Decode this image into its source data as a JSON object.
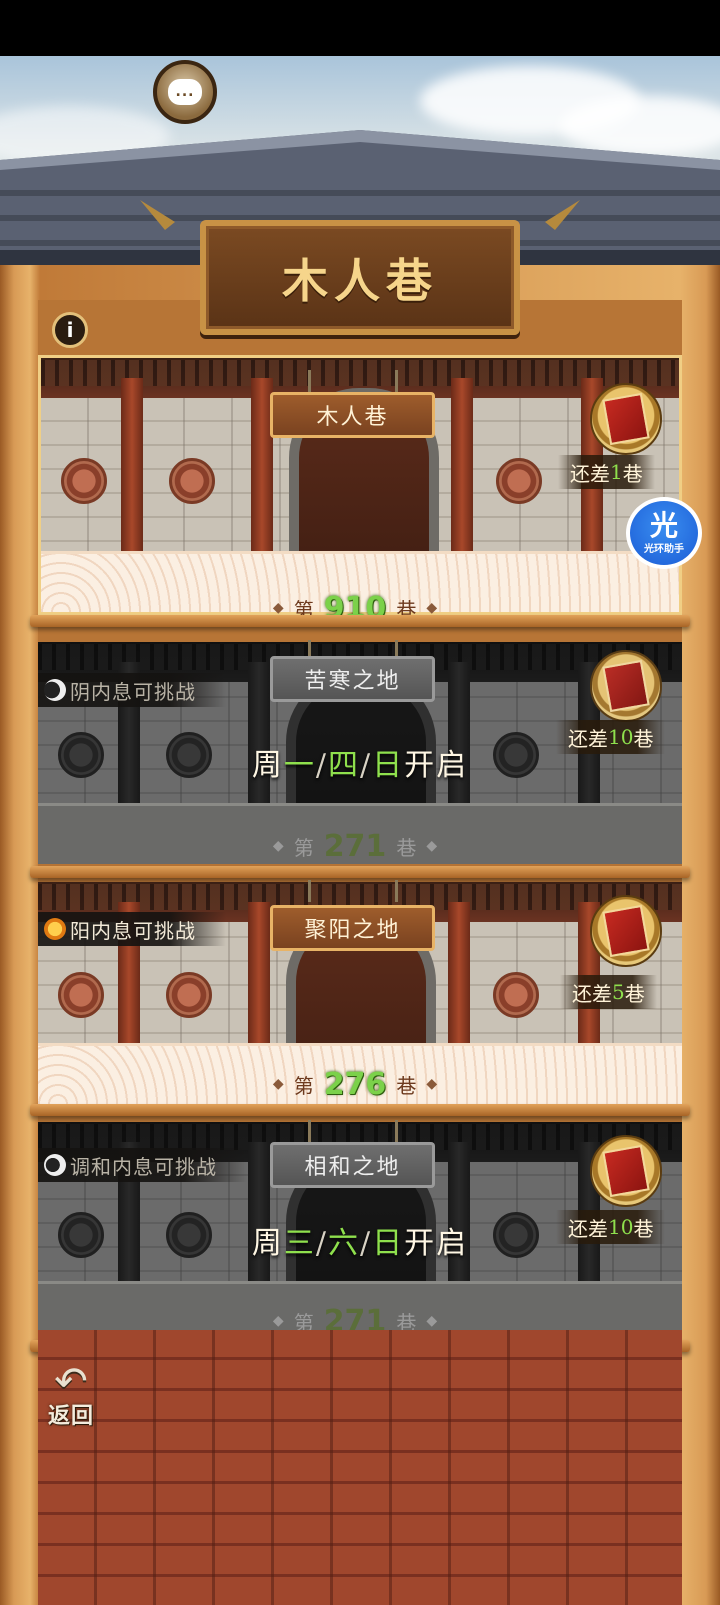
{
  "header": {
    "title": "木人巷",
    "chat_icon": "chat-bubble-icon",
    "chat_glyph": "...",
    "info_glyph": "i"
  },
  "stages": [
    {
      "id": "main",
      "sign": "木人巷",
      "stage_prefix": "第",
      "stage_number": "910",
      "stage_suffix": "巷",
      "remaining_prefix": "还差",
      "remaining_number": "1",
      "remaining_suffix": "巷",
      "locked": false
    },
    {
      "id": "yin",
      "buff": "阴内息可挑战",
      "sign": "苦寒之地",
      "open_prefix": "周",
      "open_days": [
        "一",
        "四",
        "日"
      ],
      "open_suffix": "开启",
      "stage_prefix": "第",
      "stage_number": "271",
      "stage_suffix": "巷",
      "remaining_prefix": "还差",
      "remaining_number": "10",
      "remaining_suffix": "巷",
      "locked": true
    },
    {
      "id": "yang",
      "buff": "阳内息可挑战",
      "sign": "聚阳之地",
      "stage_prefix": "第",
      "stage_number": "276",
      "stage_suffix": "巷",
      "remaining_prefix": "还差",
      "remaining_number": "5",
      "remaining_suffix": "巷",
      "locked": false
    },
    {
      "id": "harmony",
      "buff": "调和内息可挑战",
      "sign": "相和之地",
      "open_prefix": "周",
      "open_days": [
        "三",
        "六",
        "日"
      ],
      "open_suffix": "开启",
      "stage_prefix": "第",
      "stage_number": "271",
      "stage_suffix": "巷",
      "remaining_prefix": "还差",
      "remaining_number": "10",
      "remaining_suffix": "巷",
      "locked": true
    }
  ],
  "separator": "/",
  "diamond": "◆",
  "helper": {
    "glyph": "光",
    "label": "光环助手"
  },
  "back": {
    "arrow": "↶",
    "label": "返回"
  },
  "colors": {
    "accent_green": "#8fe04d",
    "wood": "#b77536",
    "sign_text": "#f6d58b"
  }
}
